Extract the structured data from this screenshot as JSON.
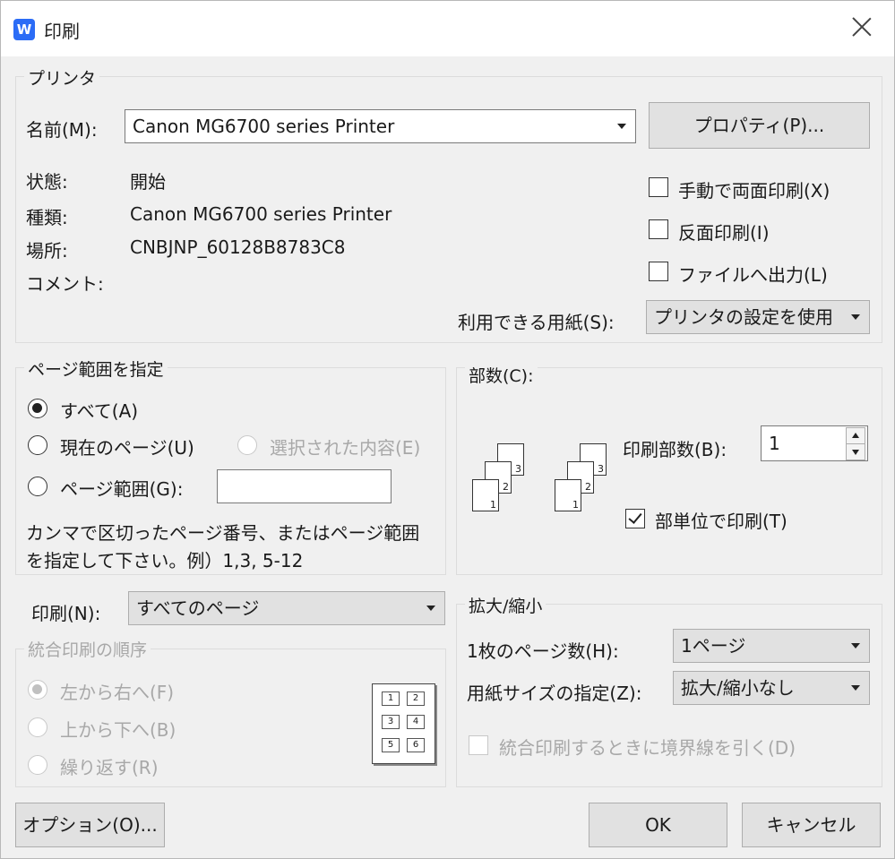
{
  "window": {
    "title": "印刷",
    "app_icon": "wps-writer-icon"
  },
  "printer": {
    "legend": "プリンタ",
    "name_label": "名前(M):",
    "name_value": "Canon MG6700 series Printer",
    "properties_button": "プロパティ(P)...",
    "status_label": "状態:",
    "status_value": "開始",
    "type_label": "種類:",
    "type_value": "Canon MG6700 series Printer",
    "location_label": "場所:",
    "location_value": "CNBJNP_60128B8783C8",
    "comment_label": "コメント:",
    "manual_duplex": {
      "label": "手動で両面印刷(X)",
      "checked": false
    },
    "reverse": {
      "label": "反面印刷(I)",
      "checked": false
    },
    "print_to_file": {
      "label": "ファイルへ出力(L)",
      "checked": false
    },
    "paper_label": "利用できる用紙(S):",
    "paper_value": "プリンタの設定を使用"
  },
  "page_range": {
    "legend": "ページ範囲を指定",
    "all": "すべて(A)",
    "current": "現在のページ(U)",
    "selection": "選択された内容(E)",
    "pages": "ページ範囲(G):",
    "pages_value": "",
    "hint_line1": "カンマで区切ったページ番号、またはページ範囲",
    "hint_line2": "を指定して下さい。例）1,3, 5-12",
    "selected": "all"
  },
  "copies": {
    "legend": "部数(C):",
    "count_label": "印刷部数(B):",
    "count_value": "1",
    "collate": {
      "label": "部単位で印刷(T)",
      "checked": true
    }
  },
  "print_what": {
    "label": "印刷(N):",
    "value": "すべてのページ"
  },
  "order": {
    "legend": "統合印刷の順序",
    "left_to_right": "左から右へ(F)",
    "top_to_bottom": "上から下へ(B)",
    "repeat": "繰り返す(R)",
    "grid": [
      "1",
      "2",
      "3",
      "4",
      "5",
      "6"
    ]
  },
  "zoom": {
    "legend": "拡大/縮小",
    "pages_per_sheet_label": "1枚のページ数(H):",
    "pages_per_sheet_value": "1ページ",
    "scale_label": "用紙サイズの指定(Z):",
    "scale_value": "拡大/縮小なし",
    "draw_borders": {
      "label": "統合印刷するときに境界線を引く(D)",
      "checked": false
    }
  },
  "footer": {
    "options": "オプション(O)...",
    "ok": "OK",
    "cancel": "キャンセル"
  }
}
